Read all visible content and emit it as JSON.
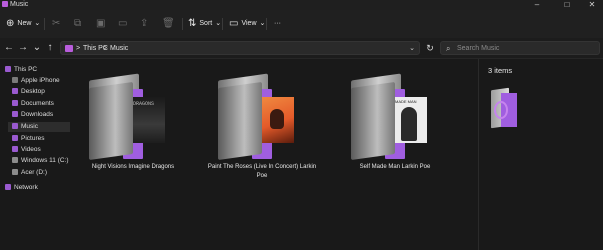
{
  "window": {
    "title": "Music"
  },
  "toolbar": {
    "new_label": "New",
    "sort_label": "Sort",
    "view_label": "View",
    "more_label": "···"
  },
  "address": {
    "crumbs": [
      "This PC",
      "Music"
    ],
    "separator": ">",
    "search_placeholder": "Search Music"
  },
  "sidebar": {
    "items": [
      {
        "label": "This PC",
        "icon": "pc-icon"
      },
      {
        "label": "Apple iPhone",
        "icon": "phone-icon"
      },
      {
        "label": "Desktop",
        "icon": "desktop-icon"
      },
      {
        "label": "Documents",
        "icon": "documents-icon"
      },
      {
        "label": "Downloads",
        "icon": "downloads-icon"
      },
      {
        "label": "Music",
        "icon": "music-icon",
        "selected": true
      },
      {
        "label": "Pictures",
        "icon": "pictures-icon"
      },
      {
        "label": "Videos",
        "icon": "videos-icon"
      },
      {
        "label": "Windows 11 (C:)",
        "icon": "drive-icon"
      },
      {
        "label": "Acer (D:)",
        "icon": "drive-icon"
      },
      {
        "label": "Network",
        "icon": "network-icon"
      }
    ]
  },
  "folders": [
    {
      "label": "Night Visions Imagine Dragons",
      "art_text": "DRAGONS"
    },
    {
      "label": "Paint The Roses (Live In Concert) Larkin Poe",
      "art_text": ""
    },
    {
      "label": "Self Made Man Larkin Poe",
      "art_text": "MADE MAN"
    }
  ],
  "details": {
    "item_count": "3 items"
  },
  "colors": {
    "accent": "#b95ddc",
    "background": "#191919"
  }
}
